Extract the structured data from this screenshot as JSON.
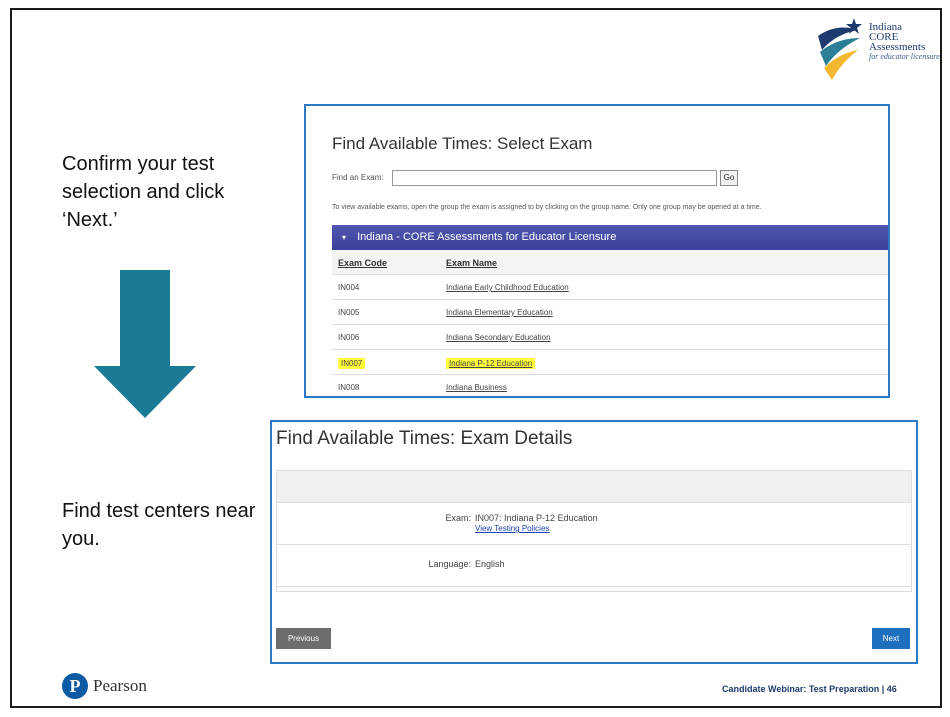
{
  "logo": {
    "line1": "Indiana",
    "line2": "CORE",
    "line3": "Assessments",
    "line4": "for educator licensure"
  },
  "instructions": {
    "step1": "Confirm your test selection and click ‘Next.’",
    "step2": "Find test centers near you."
  },
  "select_exam": {
    "title": "Find Available Times: Select Exam",
    "find_label": "Find an Exam:",
    "find_value": "",
    "go_label": "Go",
    "info_text": "To view available exams, open the group the exam is assigned to by clicking on the group name. Only one group may be opened at a time.",
    "group_caret": "▾",
    "group_name": "Indiana - CORE Assessments for Educator Licensure",
    "columns": [
      "Exam Code",
      "Exam Name"
    ],
    "rows": [
      {
        "code": "IN004",
        "name": "Indiana Early Childhood Education"
      },
      {
        "code": "IN005",
        "name": "Indiana Elementary Education"
      },
      {
        "code": "IN006",
        "name": "Indiana Secondary Education"
      },
      {
        "code": "IN007",
        "name": "Indiana P-12 Education"
      },
      {
        "code": "IN008",
        "name": "Indiana Business"
      }
    ],
    "highlight_color": "#ffff3a"
  },
  "exam_details": {
    "title": "Find Available Times: Exam Details",
    "exam_label": "Exam:",
    "exam_value": "IN007: Indiana P-12 Education",
    "policy_link": "View Testing Policies",
    "language_label": "Language:",
    "language_value": "English",
    "previous_label": "Previous",
    "next_label": "Next"
  },
  "footer": {
    "brand_initial": "P",
    "brand": "Pearson",
    "caption": "Candidate Webinar: Test Preparation | 46"
  },
  "colors": {
    "arrow": "#1b7a96",
    "frame_border": "#2b79c7",
    "group_bar": "#4249a3",
    "next_button": "#1f6fbf"
  }
}
